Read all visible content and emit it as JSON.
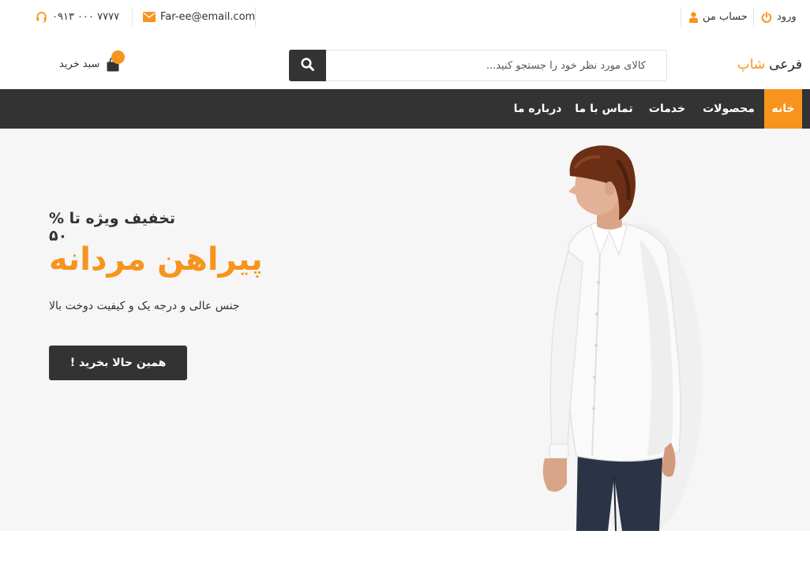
{
  "topbar": {
    "phone": "۰۹۱۳ ۰۰۰ ۷۷۷۷",
    "email": "Far-ee@email.com",
    "account": "حساب من",
    "login": "ورود",
    "icons": {
      "phone": "headset-icon",
      "email": "envelope-icon",
      "account": "user-icon",
      "login": "power-icon"
    }
  },
  "header": {
    "logo_main": "فرعی",
    "logo_accent": "شاپ",
    "search_placeholder": "کالای مورد نظر خود را جستجو کنید...",
    "cart_label": "سبد خرید",
    "cart_count": "۰"
  },
  "nav": {
    "items": [
      {
        "label": "خانه",
        "active": true
      },
      {
        "label": "محصولات"
      },
      {
        "label": "خدمات"
      },
      {
        "label": "تماس با ما"
      },
      {
        "label": "درباره ما"
      }
    ]
  },
  "hero": {
    "subtitle": "تخفیف ویژه تا % ۵۰",
    "title": "پیراهن مردانه",
    "description": "جنس عالی و درجه یک و کیفیت دوخت بالا",
    "button": "همین حالا بخرید !"
  },
  "colors": {
    "accent": "#f7941d",
    "dark": "#333333",
    "hero_bg": "#f6f6f6"
  }
}
